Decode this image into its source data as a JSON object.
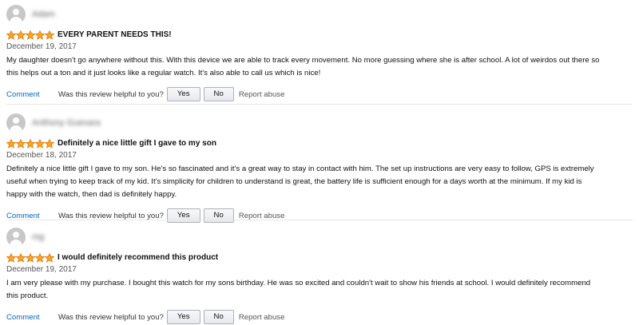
{
  "colors": {
    "star": "#f5a623",
    "star_outline": "#e47911",
    "link": "#0066c0",
    "button_border": "#adb1b8"
  },
  "reviews": [
    {
      "reviewer": "Adam",
      "rating": 5,
      "title": "EVERY PARENT NEEDS THIS!",
      "date": "December 19, 2017",
      "body": "My daughter doesn't go anywhere without this. With this device we are able to track every movement. No more guessing where she is after school. A lot of weirdos out there so\nthis helps out a ton and it just looks like a regular watch. It's also able to call us which is nice!",
      "comment_label": "Comment",
      "helpful_question": "Was this review helpful to you?",
      "yes_label": "Yes",
      "no_label": "No",
      "report_label": "Report abuse"
    },
    {
      "reviewer": "Anthony Guevara",
      "rating": 5,
      "title": "Definitely a nice little gift I gave to my son",
      "date": "December 18, 2017",
      "body": "Definitely a nice little gift I gave to my son. He's so fascinated and it's a great way to stay in contact with him. The set up instructions are very easy to follow, GPS is extremely\nuseful when trying to keep track of my kid. It's simplicity for children to understand is great, the battery life is sufficient enough for a days worth at the minimum. If my kid is\nhappy with the watch, then dad is definitely happy.",
      "comment_label": "Comment",
      "helpful_question": "Was this review helpful to you?",
      "yes_label": "Yes",
      "no_label": "No",
      "report_label": "Report abuse"
    },
    {
      "reviewer": "mg",
      "rating": 5,
      "title": "I would definitely recommend this product",
      "date": "December 19, 2017",
      "body": "I am very please with my purchase. I bought this watch for my sons birthday. He was so excited and couldn't wait to show his friends at school. I would definitely recommend\nthis product.",
      "comment_label": "Comment",
      "helpful_question": "Was this review helpful to you?",
      "yes_label": "Yes",
      "no_label": "No",
      "report_label": "Report abuse"
    }
  ]
}
